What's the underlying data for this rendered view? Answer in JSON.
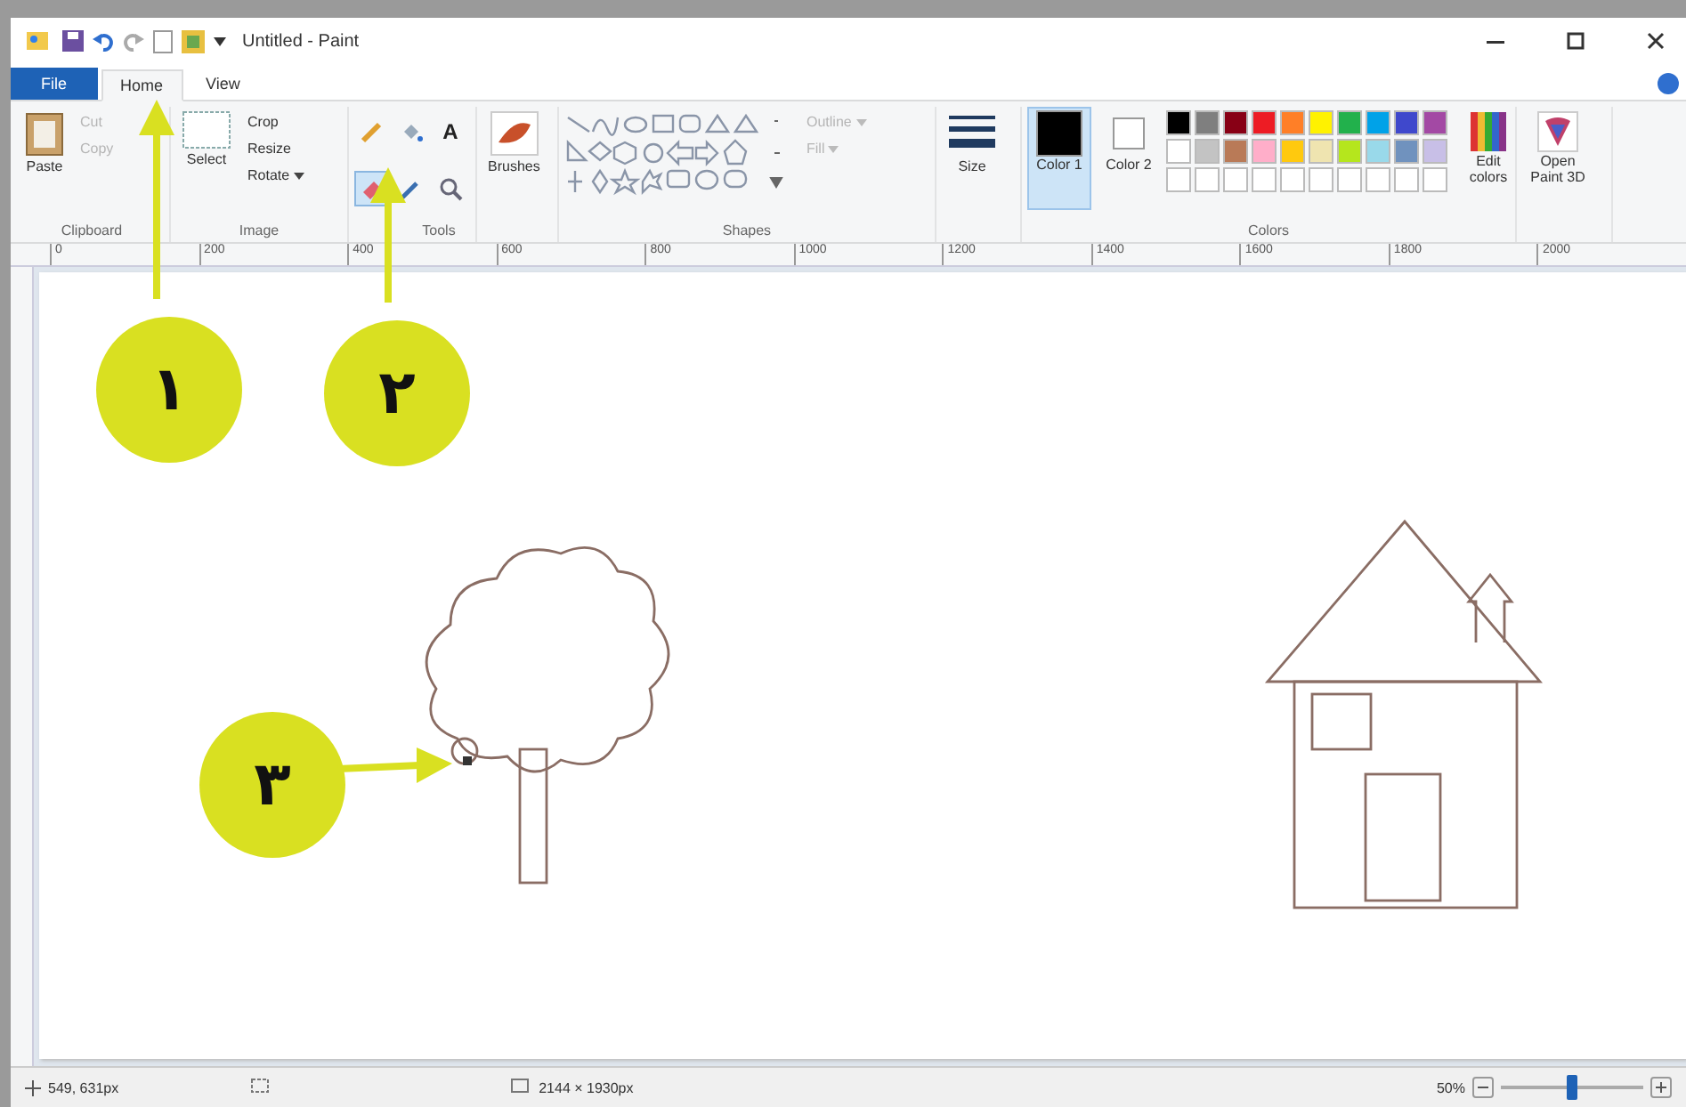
{
  "window": {
    "title": "Untitled - Paint"
  },
  "tabs": [
    {
      "label": "File",
      "kind": "file",
      "selected": false
    },
    {
      "label": "Home",
      "kind": "tab",
      "selected": true
    },
    {
      "label": "View",
      "kind": "tab",
      "selected": false
    }
  ],
  "clipboard": {
    "label": "Clipboard",
    "paste": "Paste",
    "cut": {
      "label": "Cut",
      "disabled": true
    },
    "copy": {
      "label": "Copy",
      "disabled": true
    }
  },
  "image": {
    "label": "Image",
    "select": "Select",
    "crop": "Crop",
    "resize": "Resize",
    "rotate": "Rotate"
  },
  "tools": {
    "label": "Tools",
    "items": [
      {
        "kind": "pencil",
        "selected": false
      },
      {
        "kind": "fill",
        "selected": false
      },
      {
        "kind": "text",
        "glyph": "A",
        "selected": false
      },
      {
        "kind": "eraser",
        "selected": true
      },
      {
        "kind": "picker",
        "selected": false
      },
      {
        "kind": "magnifier",
        "selected": false
      }
    ]
  },
  "brushes": {
    "label": "Brushes"
  },
  "shapes": {
    "label": "Shapes",
    "outline": {
      "label": "Outline",
      "disabled": true
    },
    "fill": {
      "label": "Fill",
      "disabled": true
    }
  },
  "size": {
    "label": "Size"
  },
  "colors": {
    "label": "Colors",
    "color1": {
      "label": "Color 1",
      "color": "#000000",
      "selected": true
    },
    "color2": {
      "label": "Color 2",
      "color": "#ffffff",
      "selected": false
    },
    "palette": [
      {
        "color": "#000000"
      },
      {
        "color": "#7f7f7f"
      },
      {
        "color": "#880015"
      },
      {
        "color": "#ed1c24"
      },
      {
        "color": "#ff7f27"
      },
      {
        "color": "#fff200"
      },
      {
        "color": "#22b14c"
      },
      {
        "color": "#00a2e8"
      },
      {
        "color": "#3f48cc"
      },
      {
        "color": "#a349a4"
      },
      {
        "color": "#ffffff"
      },
      {
        "color": "#c3c3c3"
      },
      {
        "color": "#b97a57"
      },
      {
        "color": "#ffaec9"
      },
      {
        "color": "#ffc90e"
      },
      {
        "color": "#efe4b0"
      },
      {
        "color": "#b5e61d"
      },
      {
        "color": "#99d9ea"
      },
      {
        "color": "#7092be"
      },
      {
        "color": "#c8bfe7"
      }
    ],
    "edit": "Edit colors"
  },
  "paint3d": {
    "label": "Open Paint 3D"
  },
  "ruler": [
    "0",
    "200",
    "400",
    "600",
    "800",
    "1000",
    "1200",
    "1400",
    "1600",
    "1800",
    "2000"
  ],
  "annotations": [
    {
      "label": "١"
    },
    {
      "label": "٢"
    },
    {
      "label": "٣"
    }
  ],
  "status_bar": {
    "position": "549, 631px",
    "size": "2144 × 1930px",
    "zoom": "50%",
    "zoom_slider": {
      "level": 0.5
    }
  }
}
